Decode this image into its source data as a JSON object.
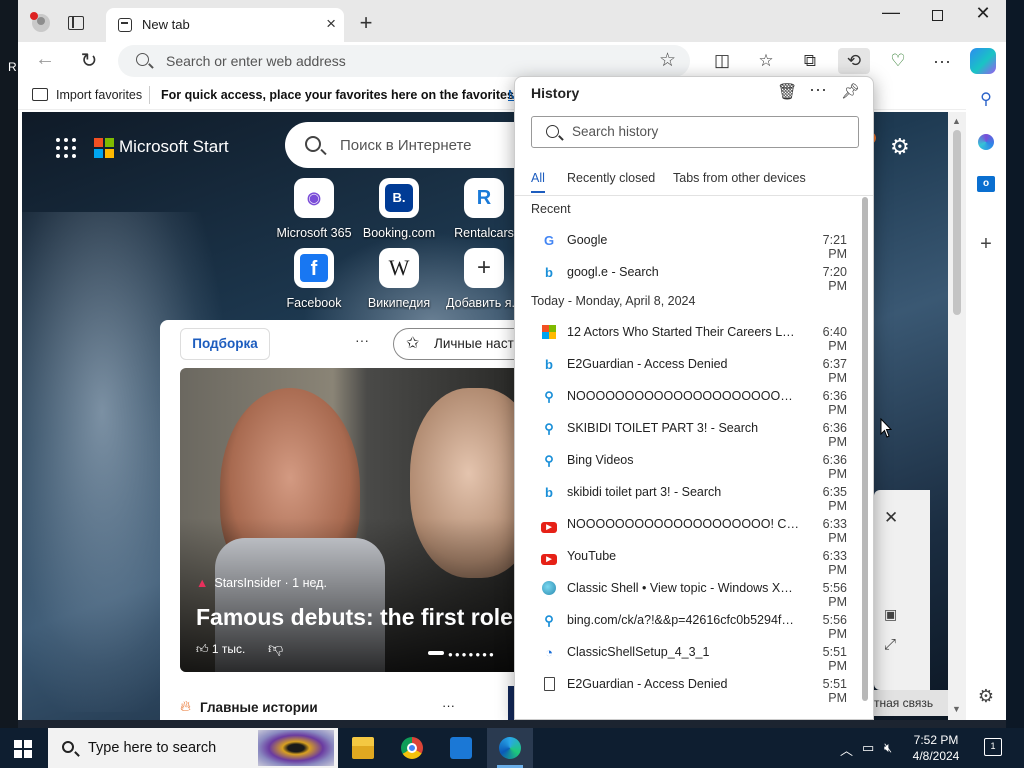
{
  "desktop": {
    "left_char": "R"
  },
  "browser": {
    "tab_title": "New tab",
    "address_placeholder": "Search or enter web address",
    "favbar": {
      "import_label": "Import favorites",
      "message": "For quick access, place your favorites here on the favorites bar.",
      "link": "M"
    }
  },
  "page": {
    "brand": "Microsoft Start",
    "search_placeholder": "Поиск в Интернете",
    "tiles": [
      {
        "label": "Microsoft 365",
        "glyph": "◉"
      },
      {
        "label": "Booking.com",
        "glyph": "B."
      },
      {
        "label": "Rentalcars",
        "glyph": "R"
      },
      {
        "label": "Facebook",
        "glyph": "f"
      },
      {
        "label": "Википедия",
        "glyph": "W"
      },
      {
        "label": "Добавить я...",
        "glyph": "+"
      }
    ],
    "feed_chip": "Подборка",
    "feed_chip2": "Личные наст",
    "hero": {
      "source": "StarsInsider · 1 нед.",
      "title": "Famous debuts: the first roles",
      "likes": "1 тыс."
    },
    "top_stories": "Главные истории",
    "feedback": "тная связь"
  },
  "history": {
    "title": "History",
    "search_placeholder": "Search history",
    "tabs": [
      "All",
      "Recently closed",
      "Tabs from other devices"
    ],
    "sections": [
      {
        "header": "Recent",
        "items": [
          {
            "title": "Google",
            "time": "7:21 PM",
            "icon": "google"
          },
          {
            "title": "googl.e - Search",
            "time": "7:20 PM",
            "icon": "bing"
          }
        ]
      },
      {
        "header": "Today - Monday, April 8, 2024",
        "items": [
          {
            "title": "12 Actors Who Started Their Careers Late ...",
            "time": "6:40 PM",
            "icon": "microsoft"
          },
          {
            "title": "E2Guardian - Access Denied",
            "time": "6:37 PM",
            "icon": "bing"
          },
          {
            "title": "NOOOOOOOOOOOOOOOOOOOOOOO...",
            "time": "6:36 PM",
            "icon": "search"
          },
          {
            "title": "SKIBIDI TOILET PART 3! - Search",
            "time": "6:36 PM",
            "icon": "search"
          },
          {
            "title": "Bing Videos",
            "time": "6:36 PM",
            "icon": "search"
          },
          {
            "title": "skibidi toilet part 3! - Search",
            "time": "6:35 PM",
            "icon": "bing"
          },
          {
            "title": "NOOOOOOOOOOOOOOOOOOOO! Co...",
            "time": "6:33 PM",
            "icon": "youtube"
          },
          {
            "title": "YouTube",
            "time": "6:33 PM",
            "icon": "youtube"
          },
          {
            "title": "Classic Shell • View topic - Windows XP T...",
            "time": "5:56 PM",
            "icon": "shell"
          },
          {
            "title": "bing.com/ck/a?!&&p=42616cfc0b5294fbJ...",
            "time": "5:56 PM",
            "icon": "search"
          },
          {
            "title": "ClassicShellSetup_4_3_1",
            "time": "5:51 PM",
            "icon": "edge"
          },
          {
            "title": "E2Guardian - Access Denied",
            "time": "5:51 PM",
            "icon": "page"
          }
        ]
      }
    ]
  },
  "taskbar": {
    "search_placeholder": "Type here to search",
    "time": "7:52 PM",
    "date": "4/8/2024",
    "notifications": "1"
  },
  "colors": {
    "accent": "#1d5dbf",
    "youtube": "#e62117",
    "bing": "#1a8fd8",
    "taskbar": "#0e1e30"
  }
}
